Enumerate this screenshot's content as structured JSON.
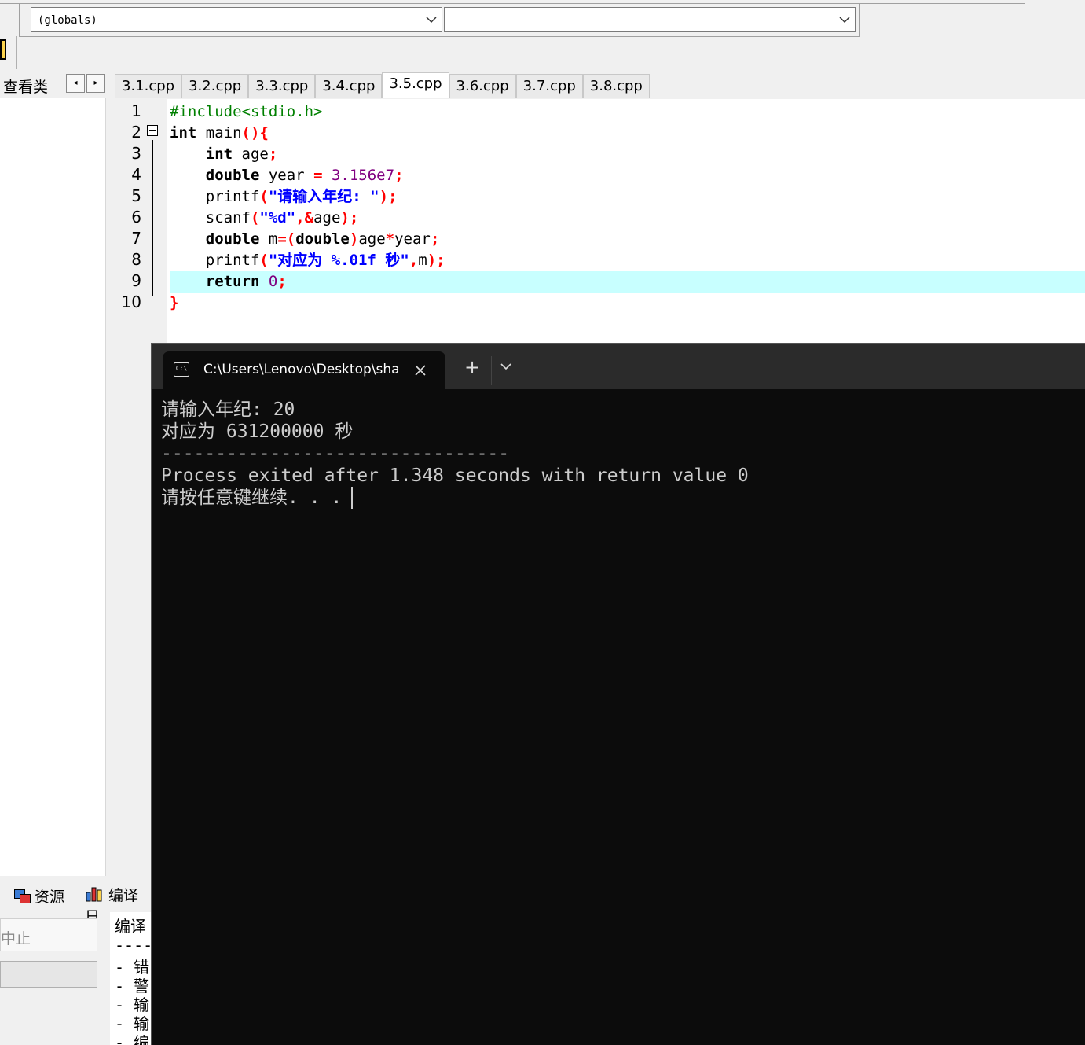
{
  "toolbar": {
    "scope_combo_value": "(globals)",
    "member_combo_value": ""
  },
  "class_view": {
    "label": "查看类",
    "nav_prev": "◂",
    "nav_next": "▸"
  },
  "editor_tabs": [
    "3.1.cpp",
    "3.2.cpp",
    "3.3.cpp",
    "3.4.cpp",
    "3.5.cpp",
    "3.6.cpp",
    "3.7.cpp",
    "3.8.cpp"
  ],
  "active_tab_index": 4,
  "editor": {
    "line_numbers": [
      "1",
      "2",
      "3",
      "4",
      "5",
      "6",
      "7",
      "8",
      "9",
      "10"
    ],
    "highlighted_line": 9,
    "code_lines": [
      "#include<stdio.h>",
      "int main(){",
      "    int age;",
      "    double year = 3.156e7;",
      "    printf(\"请输入年纪: \");",
      "    scanf(\"%d\",&age);",
      "    double m=(double)age*year;",
      "    printf(\"对应为 %.01f 秒\",m);",
      "    return 0;",
      "}"
    ]
  },
  "bottom_panel": {
    "resources_tab": "资源",
    "compile_log_tab": "编译日",
    "stop_button": "中止",
    "compile_log_title": "编译",
    "compile_log_lines": [
      "----",
      "- 错",
      "- 警",
      "- 输",
      "- 输",
      "- 编"
    ]
  },
  "terminal": {
    "tab_title": "C:\\Users\\Lenovo\\Desktop\\sha",
    "new_tab": "+",
    "output_lines": [
      "请输入年纪: 20",
      "对应为 631200000 秒",
      "--------------------------------",
      "Process exited after 1.348 seconds with return value 0",
      "请按任意键继续. . ."
    ]
  },
  "colors": {
    "keyword": "#000000",
    "preprocessor": "#008000",
    "number": "#800080",
    "string": "#0000ff",
    "symbol": "#ff0000",
    "current_line": "#c8ffff",
    "terminal_bg": "#0c0c0c",
    "terminal_text": "#cccccc"
  }
}
